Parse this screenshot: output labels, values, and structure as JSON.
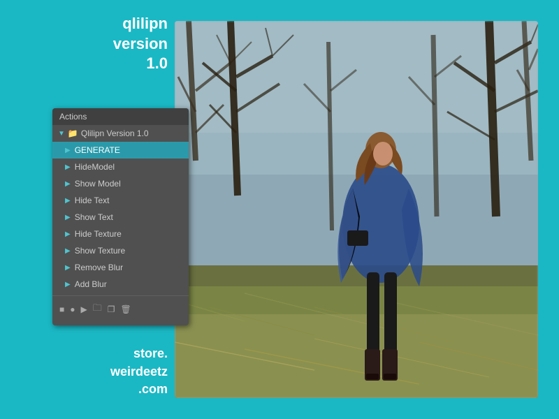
{
  "title": {
    "line1": "qlilipn",
    "line2": "version",
    "line3": "1.0"
  },
  "store": {
    "line1": "store.",
    "line2": "weirdeetz",
    "line3": ".com"
  },
  "panel": {
    "header": "Actions",
    "folder_label": "Qlilipn Version 1.0",
    "items": [
      {
        "label": "GENERATE",
        "active": true
      },
      {
        "label": "HideModel",
        "active": false
      },
      {
        "label": "Show Model",
        "active": false
      },
      {
        "label": "Hide Text",
        "active": false
      },
      {
        "label": "Show Text",
        "active": false
      },
      {
        "label": "Hide Texture",
        "active": false
      },
      {
        "label": "Show Texture",
        "active": false
      },
      {
        "label": "Remove Blur",
        "active": false
      },
      {
        "label": "Add Blur",
        "active": false
      }
    ],
    "toolbar_icons": [
      "■",
      "●",
      "▶",
      "📁",
      "❐",
      "🗑"
    ]
  },
  "colors": {
    "background": "#1ab8c4",
    "panel_bg": "#505050",
    "active_row": "#2a9aaa",
    "accent": "#4fc4cf"
  }
}
